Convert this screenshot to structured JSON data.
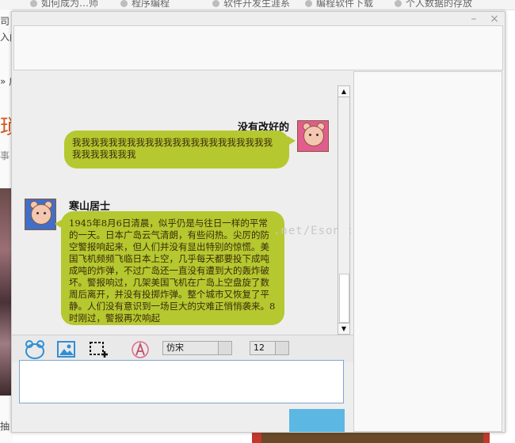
{
  "background_page": {
    "top_links": [
      "如何成为…师",
      "程序编程",
      "软件开发生涯系",
      "编程软件下载",
      "个人数据的存放"
    ],
    "left_fragments": [
      "司",
      "入门",
      "» 广",
      "琐",
      "事",
      "抽"
    ]
  },
  "window": {
    "minimize_label": "–",
    "close_label": "×"
  },
  "messages": [
    {
      "sender": "没有改好的",
      "text": "我我我我我我我我我我我我我我我我我我我我我我我我我我我我我",
      "side": "right"
    },
    {
      "sender": "寒山居士",
      "text": "1945年8月6日清晨，似乎仍是与往日一样的平常的一天。日本广岛云气清朗，有些闷热。尖厉的防空警报响起来，但人们并没有显出特别的惊慌。美国飞机频频飞临日本上空，几乎每天都要投下成吨成吨的炸弹，不过广岛还一直没有遭到大的轰炸破坏。警报响过，几架美国飞机在广岛上空盘旋了数周后离开，并没有投掷炸弹。整个城市又恢复了平静。人们没有意识到一场巨大的灾难正悄悄袭来。8时刚过，警报再次响起",
      "side": "left"
    }
  ],
  "watermark": ".net/Esonpo",
  "toolbar": {
    "font_family": "仿宋",
    "font_size": "12"
  },
  "colors": {
    "bubble": "#b5c830",
    "send_button": "#5cb8e2",
    "input_border": "#7fa6cf"
  }
}
